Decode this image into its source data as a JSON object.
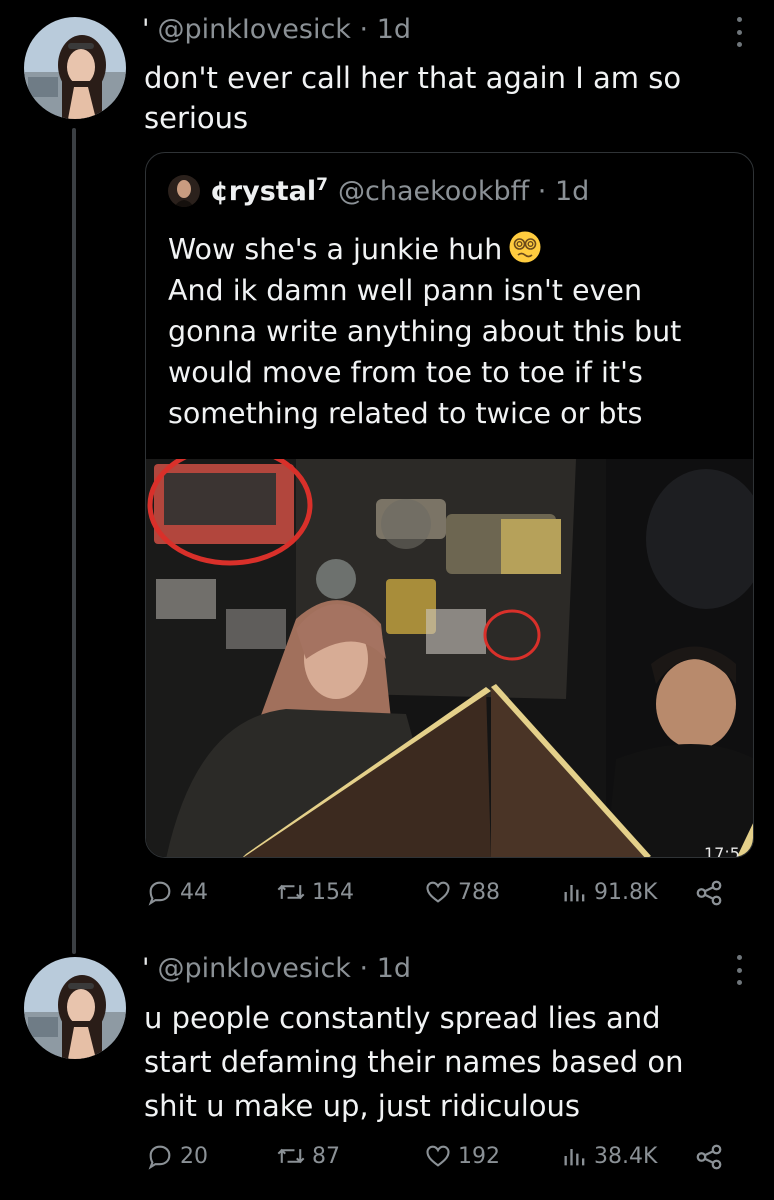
{
  "colors": {
    "background": "#000000",
    "text": "#e7e9ea",
    "muted": "#8b9196",
    "accent_red": "#d9302a"
  },
  "thread": [
    {
      "author_handle": "@pinkIovesick",
      "time": "1d",
      "text_lines": [
        "don't ever call her that again I am so",
        "serious"
      ],
      "quote": {
        "name": "¢rystal",
        "name_sup": "7",
        "handle": "@chaekookbff",
        "time": "1d",
        "text_lines": [
          "Wow she's a junkie huh",
          "And ik damn well pann isn't even",
          "gonna write anything about this but",
          "would move from toe to toe if it's",
          "something related to twice or bts"
        ],
        "emoji": "dizzy-face-emoji",
        "photo_corner_text": "17:5"
      },
      "stats": {
        "replies": "44",
        "reposts": "154",
        "likes": "788",
        "views": "91.8K"
      }
    },
    {
      "author_handle": "@pinkIovesick",
      "time": "1d",
      "text_lines": [
        "u people constantly spread lies and",
        "start defaming their names based on",
        "shit u make up, just ridiculous"
      ],
      "stats": {
        "replies": "20",
        "reposts": "87",
        "likes": "192",
        "views": "38.4K"
      }
    }
  ],
  "icons": [
    "reply-icon",
    "repost-icon",
    "like-icon",
    "views-icon",
    "share-icon",
    "more-icon"
  ]
}
